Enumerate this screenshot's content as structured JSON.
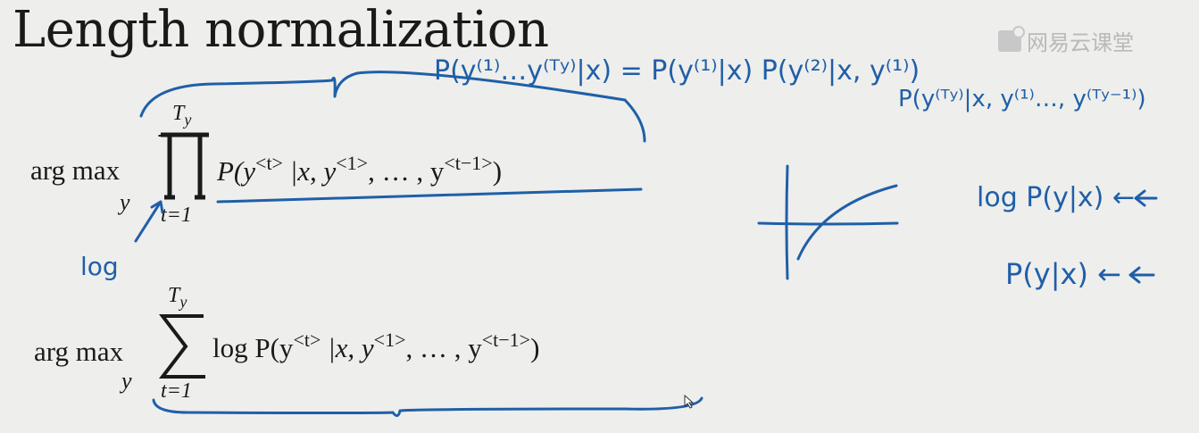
{
  "slide": {
    "title": "Length normalization",
    "watermark": "网易云课堂"
  },
  "formula_product": {
    "operator": "arg max",
    "operator_sub": "y",
    "upper_limit": "T",
    "upper_limit_sub": "y",
    "lower_limit": "t=1",
    "expr_pre": "P(y",
    "expr_sup1": "<t>",
    "expr_mid1": " |x, y",
    "expr_sup2": "<1>",
    "expr_mid2": ", … , y",
    "expr_sup3": "<t−1>",
    "expr_end": ")"
  },
  "formula_sum": {
    "operator": "arg max",
    "operator_sub": "y",
    "upper_limit": "T",
    "upper_limit_sub": "y",
    "lower_limit": "t=1",
    "expr_pre": "log P(y",
    "expr_sup1": "<t>",
    "expr_mid1": " |x, y",
    "expr_sup2": "<1>",
    "expr_mid2": ", … , y",
    "expr_sup3": "<t−1>",
    "expr_end": ")"
  },
  "annotations": {
    "log_note": "log",
    "line1": "P(y⁽¹⁾…y⁽ᵀʸ⁾|x) = P(y⁽¹⁾|x) P(y⁽²⁾|x, y⁽¹⁾)",
    "line2": "P(y⁽ᵀʸ⁾|x, y⁽¹⁾…, y⁽ᵀʸ⁻¹⁾)",
    "log_p": "log P(y|x) ←",
    "p": "P(y|x) ←",
    "ink_color": "#1f5fa8"
  }
}
